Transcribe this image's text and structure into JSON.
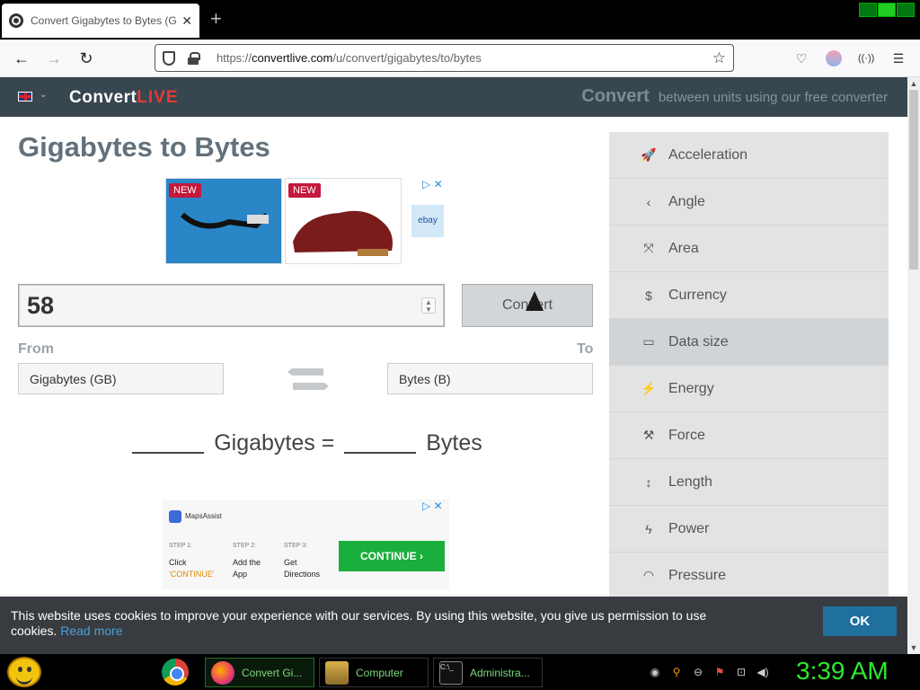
{
  "browser": {
    "tab_title": "Convert Gigabytes to Bytes (GB",
    "url_prefix": "https://",
    "url_domain": "convertlive.com",
    "url_path": "/u/convert/gigabytes/to/bytes"
  },
  "site": {
    "logo_main": "Convert",
    "logo_accent": "LIVE",
    "header_big": "Convert",
    "header_tagline": "between units using our free converter"
  },
  "converter": {
    "page_title": "Gigabytes to Bytes",
    "value": "58",
    "convert_label": "Convert",
    "from_label": "From",
    "to_label": "To",
    "from_unit": "Gigabytes (GB)",
    "to_unit": "Bytes (B)",
    "eq_from_unit": "Gigabytes =",
    "eq_to_unit": "Bytes"
  },
  "ads": {
    "badge_new": "NEW",
    "ebay": "ebay",
    "maps_brand": "MapsAssist",
    "steps": [
      {
        "num": "STEP 1:",
        "line1": "Click",
        "line2": "'CONTINUE'"
      },
      {
        "num": "STEP 2:",
        "line1": "Add the",
        "line2": "App"
      },
      {
        "num": "STEP 3:",
        "line1": "Get",
        "line2": "Directions"
      }
    ],
    "continue_label": "CONTINUE"
  },
  "sidebar": {
    "items": [
      {
        "label": "Acceleration",
        "icon": "rocket-icon",
        "glyph": "🚀"
      },
      {
        "label": "Angle",
        "icon": "angle-icon",
        "glyph": "‹"
      },
      {
        "label": "Area",
        "icon": "expand-icon",
        "glyph": "⤧"
      },
      {
        "label": "Currency",
        "icon": "dollar-icon",
        "glyph": "$"
      },
      {
        "label": "Data size",
        "icon": "hard-drive-icon",
        "glyph": "▭"
      },
      {
        "label": "Energy",
        "icon": "plug-icon",
        "glyph": "⚡"
      },
      {
        "label": "Force",
        "icon": "hammer-icon",
        "glyph": "⚒"
      },
      {
        "label": "Length",
        "icon": "arrows-vertical-icon",
        "glyph": "↕"
      },
      {
        "label": "Power",
        "icon": "bolt-icon",
        "glyph": "ϟ"
      },
      {
        "label": "Pressure",
        "icon": "gauge-icon",
        "glyph": "◠"
      }
    ],
    "active_index": 4
  },
  "cookie": {
    "text": "This website uses cookies to improve your experience with our services. By using this website, you give us permission to use cookies.",
    "link": "Read more",
    "ok_label": "OK"
  },
  "taskbar": {
    "tasks": [
      {
        "label": "Convert Gi..."
      },
      {
        "label": "Computer"
      },
      {
        "label": "Administra..."
      }
    ],
    "clock": "3:39 AM"
  },
  "colors": {
    "header_bg": "#37464f",
    "accent_red": "#e53935",
    "sidebar_bg": "#e3e3e3",
    "clock_green": "#2ee82e"
  }
}
